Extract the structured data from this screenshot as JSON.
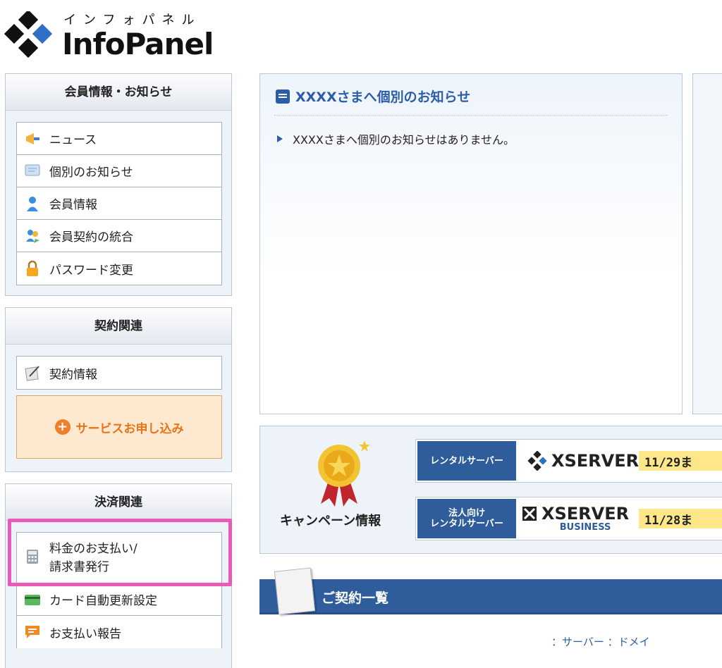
{
  "logo": {
    "kana": "インフォパネル",
    "title": "InfoPanel"
  },
  "sidebar": {
    "member": {
      "heading": "会員情報・お知らせ",
      "items": [
        {
          "label": "ニュース",
          "icon": "megaphone-icon"
        },
        {
          "label": "個別のお知らせ",
          "icon": "message-icon"
        },
        {
          "label": "会員情報",
          "icon": "user-icon"
        },
        {
          "label": "会員契約の統合",
          "icon": "merge-users-icon"
        },
        {
          "label": "パスワード変更",
          "icon": "lock-icon"
        }
      ]
    },
    "contract": {
      "heading": "契約関連",
      "items": [
        {
          "label": "契約情報",
          "icon": "contract-pen-icon"
        }
      ],
      "service_button": "サービスお申し込み"
    },
    "payment": {
      "heading": "決済関連",
      "items": [
        {
          "label": "料金のお支払い/\n請求書発行",
          "icon": "calculator-icon"
        },
        {
          "label": "カード自動更新設定",
          "icon": "credit-card-icon"
        },
        {
          "label": "お支払い報告",
          "icon": "report-icon"
        }
      ]
    }
  },
  "notice": {
    "title": "XXXXさまへ個別のお知らせ",
    "body": "XXXXさまへ個別のお知らせはありません。"
  },
  "campaign": {
    "label": "キャンペーン情報",
    "rows": [
      {
        "tag": "レンタルサーバー",
        "brand": "XSERVER",
        "sub": "",
        "date": "11/29ま"
      },
      {
        "tag": "法人向け\nレンタルサーバー",
        "brand": "XSERVER",
        "sub": "BUSINESS",
        "date": "11/28ま"
      }
    ]
  },
  "contracts": {
    "title": "ご契約一覧"
  },
  "bottom_links": "：サーバー  ：ドメイ",
  "colors": {
    "accent_blue": "#2f5d9c",
    "link_blue": "#2b5ea8",
    "orange": "#e8731a",
    "highlight_pink": "#ea5bb8",
    "date_yellow": "#fde78a"
  }
}
